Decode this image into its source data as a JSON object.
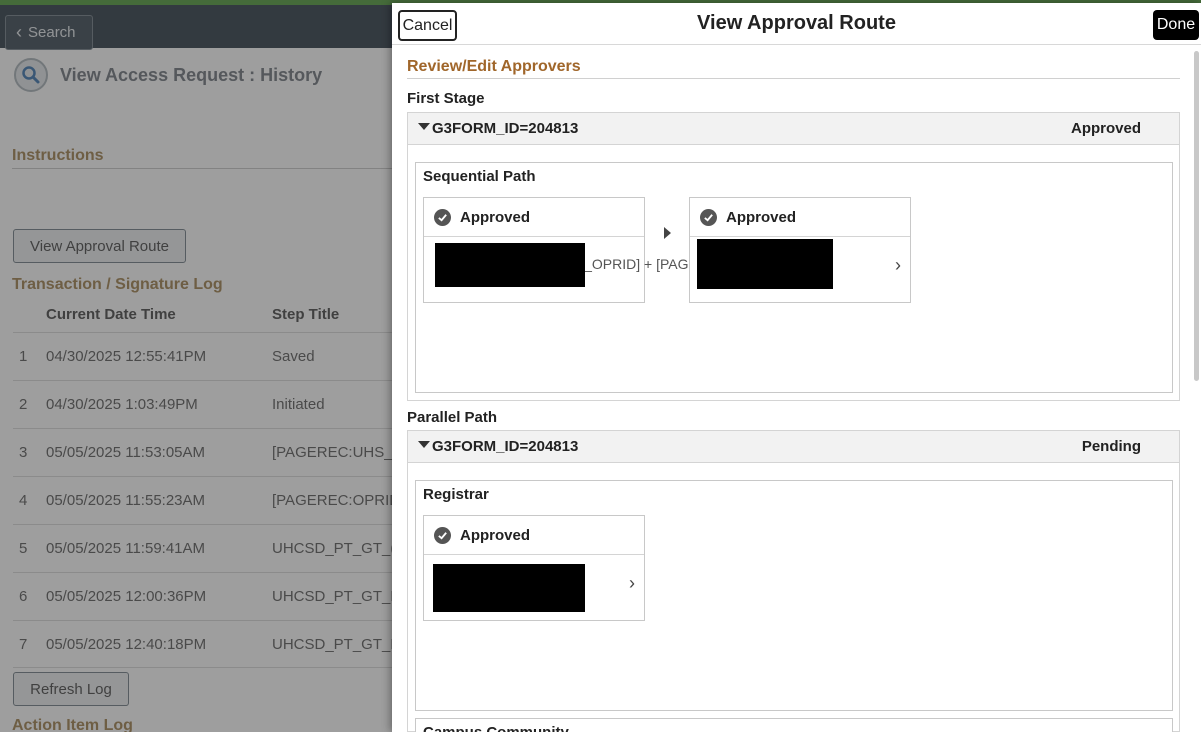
{
  "background": {
    "search_button": "Search",
    "page_title": "View Access Request :  History",
    "instructions_label": "Instructions",
    "view_route_button": "View Approval Route",
    "log_title": "Transaction / Signature Log",
    "columns": [
      "Current Date Time",
      "Step Title"
    ],
    "rows": [
      {
        "num": "1",
        "datetime": "04/30/2025 12:55:41PM",
        "step": "Saved"
      },
      {
        "num": "2",
        "datetime": "04/30/2025  1:03:49PM",
        "step": "Initiated"
      },
      {
        "num": "3",
        "datetime": "05/05/2025 11:53:05AM",
        "step": "[PAGEREC:UHS_"
      },
      {
        "num": "4",
        "datetime": "05/05/2025 11:55:23AM",
        "step": "[PAGEREC:OPRID"
      },
      {
        "num": "5",
        "datetime": "05/05/2025 11:59:41AM",
        "step": "UHCSD_PT_GT_("
      },
      {
        "num": "6",
        "datetime": "05/05/2025 12:00:36PM",
        "step": "UHCSD_PT_GT_F"
      },
      {
        "num": "7",
        "datetime": "05/05/2025 12:40:18PM",
        "step": "UHCSD_PT_GT_F"
      }
    ],
    "refresh_button": "Refresh Log",
    "action_log_title": "Action Item Log"
  },
  "modal": {
    "cancel_label": "Cancel",
    "title": "View Approval Route",
    "done_label": "Done",
    "review_title": "Review/Edit Approvers",
    "stage1": {
      "label": "First Stage",
      "group_id": "G3FORM_ID=204813",
      "group_status": "Approved",
      "path_title": "Sequential Path",
      "card1_status": "Approved",
      "card1_text": "R_OPRID] + [PAG",
      "card2_status": "Approved"
    },
    "stage2": {
      "label": "Parallel Path",
      "group_id": "G3FORM_ID=204813",
      "group_status": "Pending",
      "path_title": "Registrar",
      "card1_status": "Approved",
      "next_path_title": "Campus Community"
    }
  }
}
